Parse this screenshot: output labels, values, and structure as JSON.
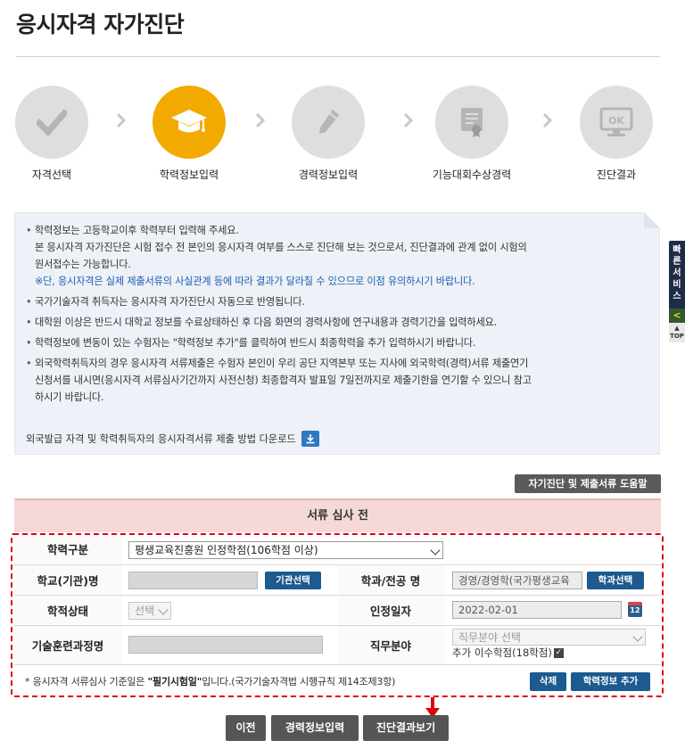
{
  "page": {
    "title": "응시자격 자가진단"
  },
  "steps": [
    {
      "label": "자격선택",
      "icon": "checkmark-icon"
    },
    {
      "label": "학력정보입력",
      "icon": "graduation-cap-icon"
    },
    {
      "label": "경력정보입력",
      "icon": "pencil-icon"
    },
    {
      "label": "기능대회수상경력",
      "icon": "certificate-icon"
    },
    {
      "label": "진단결과",
      "icon": "monitor-ok-icon"
    }
  ],
  "side": {
    "quick_service": "빠른서비스",
    "arrow": "<",
    "top": "TOP"
  },
  "notice": {
    "item1_line1": "학력정보는 고등학교이후 학력부터 입력해 주세요.",
    "item1_line2": "본 응시자격 자가진단은 시험 접수 전 본인의 응시자격 여부를 스스로 진단해 보는 것으로서, 진단결과에 관계 없이 시험의",
    "item1_line3": "원서접수는 가능합니다.",
    "item1_note": "※단, 응시자격은 실제 제출서류의 사실관계 등에 따라 결과가 달라질 수 있으므로 이점 유의하시기 바랍니다.",
    "item2": "국가기술자격 취득자는 응시자격 자가진단시 자동으로 반영됩니다.",
    "item3": "대학원 이상은 반드시 대학교 정보를 수료상태하신 후 다음 화면의 경력사항에 연구내용과 경력기간을 입력하세요.",
    "item4": "학력정보에 변동이 있는 수험자는 \"학력정보 추가\"를 클릭하여 반드시 최종학력을 추가 입력하시기 바랍니다.",
    "item5_line1": "외국학력취득자의 경우 응시자격 서류제출은 수험자 본인이 우리 공단 지역본부 또는 지사에 외국학력(경력)서류 제출연기",
    "item5_line2": "신청서를 내시면(응시자격 서류심사기간까지 사전신청) 최종합격자 발표일 7일전까지로 제출기한을 연기할 수 있으니 참고",
    "item5_line3": "하시기 바랍니다.",
    "download_text": "외국발급 자격 및 학력취득자의 응시자격서류 제출 방법 다운로드"
  },
  "help_button": "자기진단 및 제출서류 도움말",
  "table": {
    "header": "서류 심사 전",
    "edu_type_label": "학력구분",
    "edu_type_value": "평생교육진흥원 인정학점(106학점 이상)",
    "school_label": "학교(기관)명",
    "school_select_btn": "기관선택",
    "major_label": "학과/전공 명",
    "major_value": "경영/경영학(국가평생교육",
    "major_select_btn": "학과선택",
    "status_label": "학적상태",
    "status_value": "선택",
    "cert_date_label": "인정일자",
    "cert_date_value": "2022-02-01",
    "cal_icon_text": "12",
    "training_label": "기술훈련과정명",
    "job_label": "직무분야",
    "job_value": "직무분야 선택",
    "extra_credit": "추가 이수학점(18학점)",
    "checkbox_mark": "✓"
  },
  "footnote": {
    "prefix": "* 응시자격 서류심사 기준일은 ",
    "bold": "\"필기시험일\"",
    "suffix": "입니다.(국가기술자격법 시행규칙 제14조제3항)"
  },
  "buttons": {
    "delete": "삭제",
    "add_edu": "학력정보 추가",
    "prev": "이전",
    "career_input": "경력정보입력",
    "view_result": "진단결과보기"
  },
  "colors": {
    "active_step": "#f2a900",
    "inactive_step": "#dedede",
    "button_blue": "#1c5a8f",
    "highlight_red": "#e0000a",
    "table_header": "#f6d8d8"
  }
}
